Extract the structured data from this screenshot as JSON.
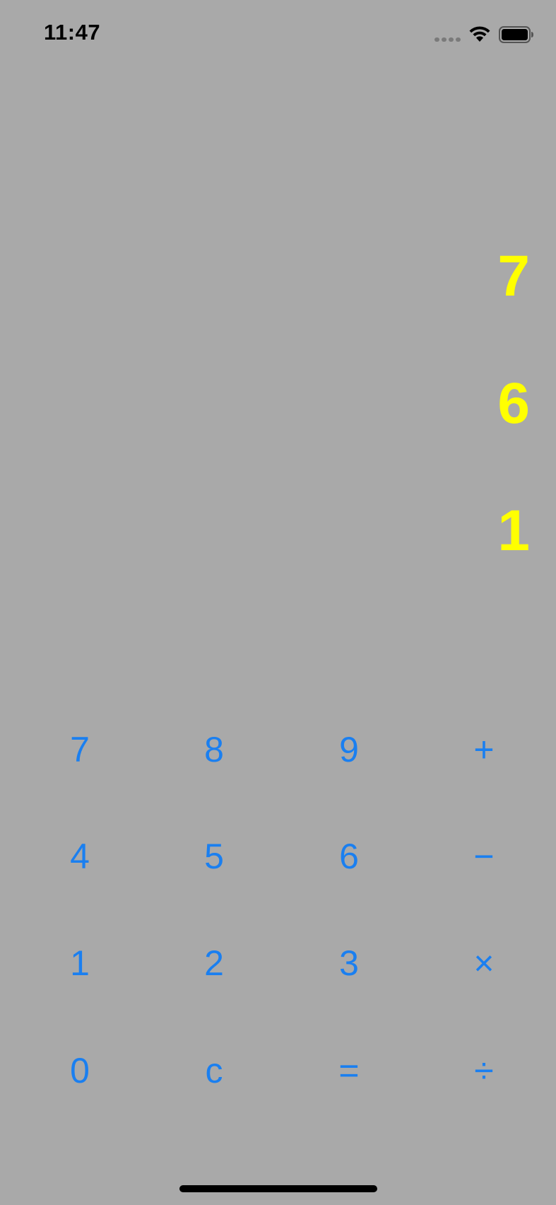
{
  "status_bar": {
    "time": "11:47",
    "icons": [
      "signal-icon",
      "wifi-icon",
      "battery-icon"
    ]
  },
  "display": {
    "lines": [
      "7",
      "6",
      "1"
    ],
    "color": "#ffff00"
  },
  "keypad": {
    "accent_color": "#1a7ff0",
    "rows": [
      [
        "7",
        "8",
        "9",
        "+"
      ],
      [
        "4",
        "5",
        "6",
        "−"
      ],
      [
        "1",
        "2",
        "3",
        "×"
      ],
      [
        "0",
        "c",
        "=",
        "÷"
      ]
    ]
  },
  "background_color": "#a9a9a9"
}
